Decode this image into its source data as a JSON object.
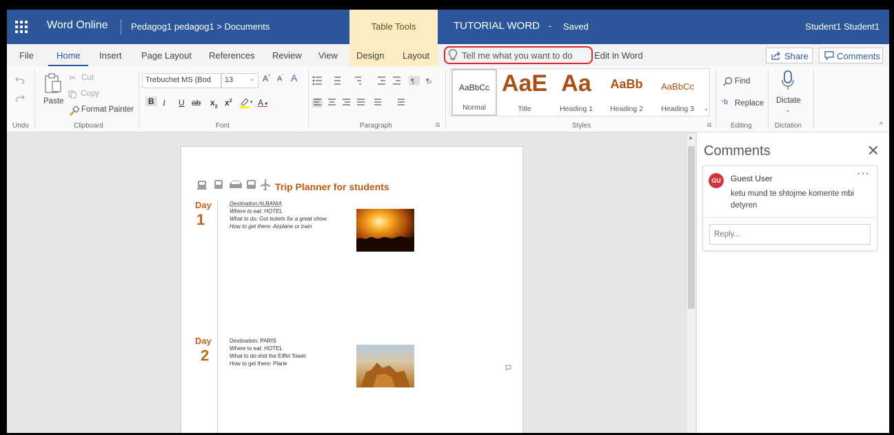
{
  "titlebar": {
    "app_name": "Word Online",
    "breadcrumb": "Pedagog1 pedagog1 > Documents",
    "contextual_tab": "Table Tools",
    "doc_title": "TUTORIAL WORD",
    "separator": "-",
    "status": "Saved",
    "user": "Student1 Student1"
  },
  "tabs": {
    "file": "File",
    "home": "Home",
    "insert": "Insert",
    "page_layout": "Page Layout",
    "references": "References",
    "review": "Review",
    "view": "View",
    "design": "Design",
    "layout": "Layout"
  },
  "tellme": {
    "placeholder": "Tell me what you want to do"
  },
  "edit_in_word": "Edit in Word",
  "share_label": "Share",
  "comments_label": "Comments",
  "ribbon": {
    "undo_group": "Undo",
    "clipboard": {
      "paste": "Paste",
      "cut": "Cut",
      "copy": "Copy",
      "format_painter": "Format Painter",
      "group": "Clipboard"
    },
    "font": {
      "name": "Trebuchet MS (Bod",
      "size": "13",
      "group": "Font",
      "bold": "B",
      "italic": "I",
      "underline": "U",
      "strike": "ab",
      "subscript": "x",
      "superscript": "x",
      "grow": "A",
      "shrink": "A",
      "font_color": "A"
    },
    "paragraph": {
      "group": "Paragraph"
    },
    "styles": {
      "items": [
        {
          "preview": "AaBbCc",
          "name": "Normal"
        },
        {
          "preview": "AaE",
          "name": "Title"
        },
        {
          "preview": "Aa",
          "name": "Heading 1"
        },
        {
          "preview": "AaBb",
          "name": "Heading 2"
        },
        {
          "preview": "AaBbCc",
          "name": "Heading 3"
        }
      ],
      "group": "Styles"
    },
    "editing": {
      "find": "Find",
      "replace": "Replace",
      "group": "Editing"
    },
    "dictation": {
      "dictate": "Dictate",
      "group": "Dictation"
    }
  },
  "document": {
    "title": "Trip Planner for students",
    "days": [
      {
        "label": "Day",
        "number": "1",
        "lines": [
          "Destination:ALBANIA",
          "Where to eat: HOTEL",
          "What to do: Got tickets for a great show.",
          "How to get there: Airplane or train"
        ]
      },
      {
        "label": "Day",
        "number": "2",
        "lines": [
          "Destination: PARIS",
          "Where to eat: HOTEL",
          "What to do:visit the Eiffel Tower",
          "How to get there: Plane"
        ]
      }
    ]
  },
  "comments_pane": {
    "title": "Comments",
    "comment": {
      "initials": "GU",
      "author": "Guest User",
      "text": "ketu mund te shtojme komente mbi detyren"
    },
    "reply_placeholder": "Reply..."
  },
  "colors": {
    "brand_blue": "#2b579a",
    "contextual_tab": "#fbecc3",
    "highlight_circle": "#d9232e",
    "heading_orange": "#b85a12",
    "avatar_red": "#d13438"
  }
}
